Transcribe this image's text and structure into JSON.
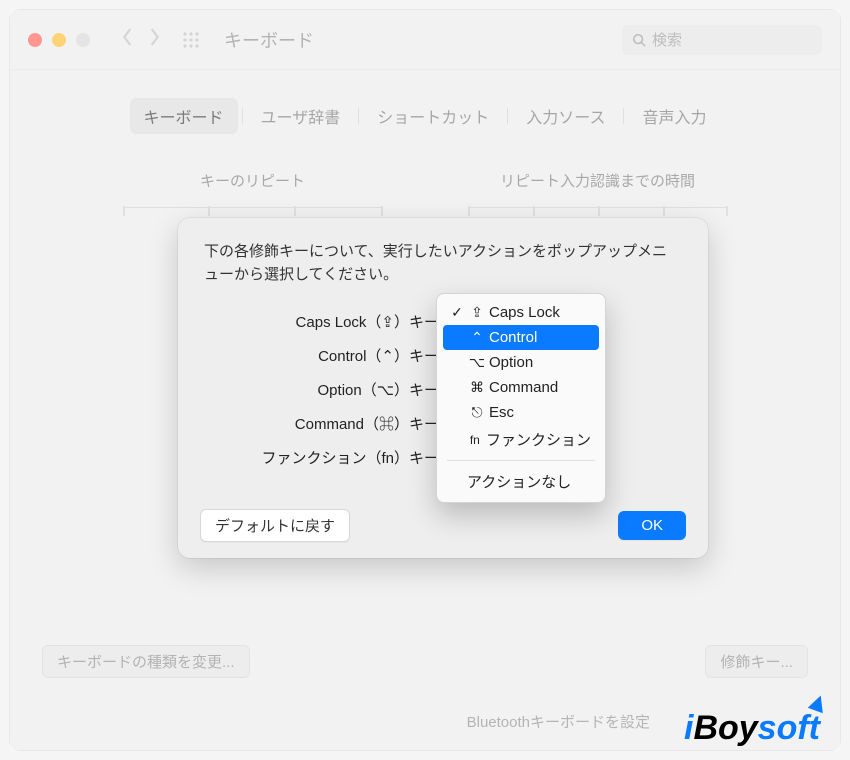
{
  "window_title": "キーボード",
  "search_placeholder": "検索",
  "tabs": {
    "keyboard": "キーボード",
    "userdict": "ユーザ辞書",
    "shortcuts": "ショートカット",
    "input_sources": "入力ソース",
    "voice_input": "音声入力"
  },
  "sliders": {
    "key_repeat": "キーのリピート",
    "delay": "リピート入力認識までの時間"
  },
  "sheet": {
    "description": "下の各修飾キーについて、実行したいアクションをポップアップメニューから選択してください。",
    "rows": {
      "caps": "Caps Lock（⇪）キー：",
      "control": "Control（⌃）キー：",
      "option": "Option（⌥）キー：",
      "command": "Command（⌘）キー：",
      "fn": "ファンクション（fn）キー："
    },
    "restore_defaults": "デフォルトに戻す",
    "ok": "OK"
  },
  "menu": {
    "caps": "Caps Lock",
    "caps_sym": "⇪",
    "control": "Control",
    "control_sym": "⌃",
    "option": "Option",
    "option_sym": "⌥",
    "command": "Command",
    "command_sym": "⌘",
    "esc": "Esc",
    "esc_sym": "⎋",
    "fn": "ファンクション",
    "fn_sym": "fn",
    "none": "アクションなし"
  },
  "bg_buttons": {
    "change_kb_type": "キーボードの種類を変更...",
    "modifier_keys": "修飾キー...",
    "bluetooth": "Bluetoothキーボードを設定"
  },
  "watermark": {
    "i": "i",
    "boy": "Boy",
    "soft": "soft"
  }
}
